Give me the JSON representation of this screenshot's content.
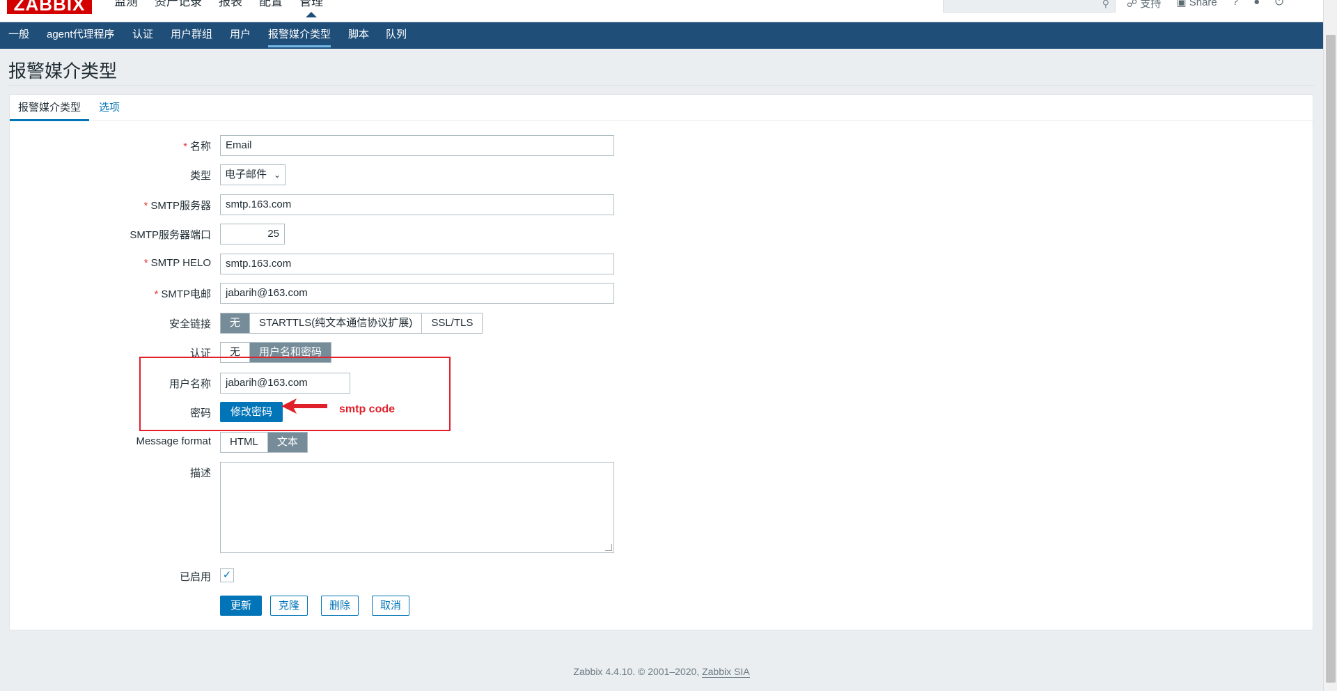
{
  "app": {
    "logo": "ZABBIX",
    "top_menu": [
      "监测",
      "资产记录",
      "报表",
      "配置",
      "管理"
    ],
    "active_top": "管理",
    "top_right": [
      "支持",
      "Share",
      "?"
    ]
  },
  "subnav": {
    "items": [
      "一般",
      "agent代理程序",
      "认证",
      "用户群组",
      "用户",
      "报警媒介类型",
      "脚本",
      "队列"
    ],
    "active": "报警媒介类型"
  },
  "page": {
    "title": "报警媒介类型"
  },
  "tabs": {
    "active": "报警媒介类型",
    "other": "选项"
  },
  "form": {
    "name": {
      "label": "名称",
      "value": "Email",
      "required": "*"
    },
    "type": {
      "label": "类型",
      "value": "电子邮件"
    },
    "smtp_server": {
      "label": "SMTP服务器",
      "value": "smtp.163.com",
      "required": "*"
    },
    "smtp_port": {
      "label": "SMTP服务器端口",
      "value": "25"
    },
    "smtp_helo": {
      "label": "SMTP HELO",
      "value": "smtp.163.com",
      "required": "*"
    },
    "smtp_email": {
      "label": "SMTP电邮",
      "value": "jabarih@163.com",
      "required": "*"
    },
    "security": {
      "label": "安全链接",
      "options": [
        "无",
        "STARTTLS(纯文本通信协议扩展)",
        "SSL/TLS"
      ],
      "selected": "无"
    },
    "auth": {
      "label": "认证",
      "options": [
        "无",
        "用户名和密码"
      ],
      "selected": "用户名和密码"
    },
    "username": {
      "label": "用户名称",
      "value": "jabarih@163.com"
    },
    "password": {
      "label": "密码",
      "button": "修改密码"
    },
    "message_format": {
      "label": "Message format",
      "options": [
        "HTML",
        "文本"
      ],
      "selected": "文本"
    },
    "description": {
      "label": "描述",
      "value": ""
    },
    "enabled": {
      "label": "已启用",
      "checked": true,
      "check_glyph": "✓"
    },
    "buttons": {
      "update": "更新",
      "clone": "克隆",
      "delete": "删除",
      "cancel": "取消"
    }
  },
  "annotation": {
    "text": "smtp code",
    "color": "#e0202a"
  },
  "footer": {
    "text": "Zabbix 4.4.10. © 2001–2020, ",
    "link": "Zabbix SIA"
  },
  "colors": {
    "nav": "#1f4e79",
    "primary": "#0275b8",
    "segment_on": "#768d99",
    "required": "#e33734"
  }
}
